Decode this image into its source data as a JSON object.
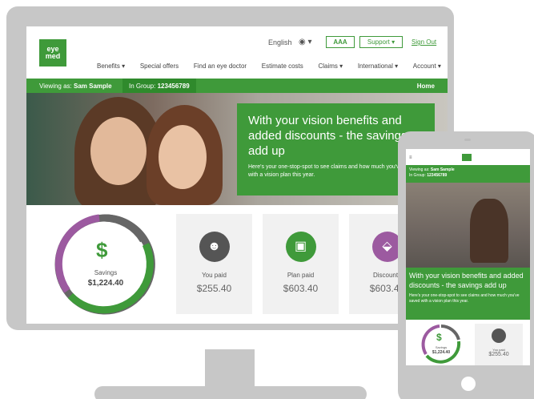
{
  "header": {
    "logo_text": "eye\nmed",
    "language": "English",
    "text_size_label": "AAA",
    "support_label": "Support ▾",
    "signout_label": "Sign Out"
  },
  "nav": {
    "items": [
      {
        "label": "Benefits ▾"
      },
      {
        "label": "Special offers"
      },
      {
        "label": "Find an eye doctor"
      },
      {
        "label": "Estimate costs"
      },
      {
        "label": "Claims ▾"
      },
      {
        "label": "International ▾"
      },
      {
        "label": "Account ▾"
      }
    ]
  },
  "member_bar": {
    "viewing_prefix": "Viewing as:",
    "viewing_name": "Sam Sample",
    "group_prefix": "In Group:",
    "group_number": "123456789",
    "home_label": "Home"
  },
  "hero": {
    "title": "With your vision benefits and added discounts - the savings add up",
    "subtitle": "Here's your one-stop-spot to see claims and how much you've saved with a vision plan this year."
  },
  "savings": {
    "label": "Savings",
    "value": "$1,224.40",
    "segments": [
      {
        "name": "You paid",
        "color": "#666666",
        "fraction": 0.21
      },
      {
        "name": "Plan paid",
        "color": "#3f9a3a",
        "fraction": 0.49
      },
      {
        "name": "Discounts",
        "color": "#9c5aa0",
        "fraction": 0.3
      }
    ]
  },
  "cards": [
    {
      "label": "You paid",
      "value": "$255.40",
      "icon": "person-icon",
      "color": "#555555"
    },
    {
      "label": "Plan paid",
      "value": "$603.40",
      "icon": "money-icon",
      "color": "#3f9a3a"
    },
    {
      "label": "Discounts",
      "value": "$603.40",
      "icon": "tag-icon",
      "color": "#9c5aa0"
    }
  ],
  "phone": {
    "viewing_prefix": "Viewing as:",
    "viewing_name": "Sam Sample",
    "group_prefix": "In Group:",
    "group_number": "123456789",
    "title": "With your vision benefits and added discounts - the savings add up",
    "subtitle": "Here's your one-stop-spot to see claims and how much you've saved with a vision plan this year.",
    "savings_label": "Savings",
    "savings_value": "$1,224.40",
    "card_label": "You paid",
    "card_value": "$255.40"
  }
}
